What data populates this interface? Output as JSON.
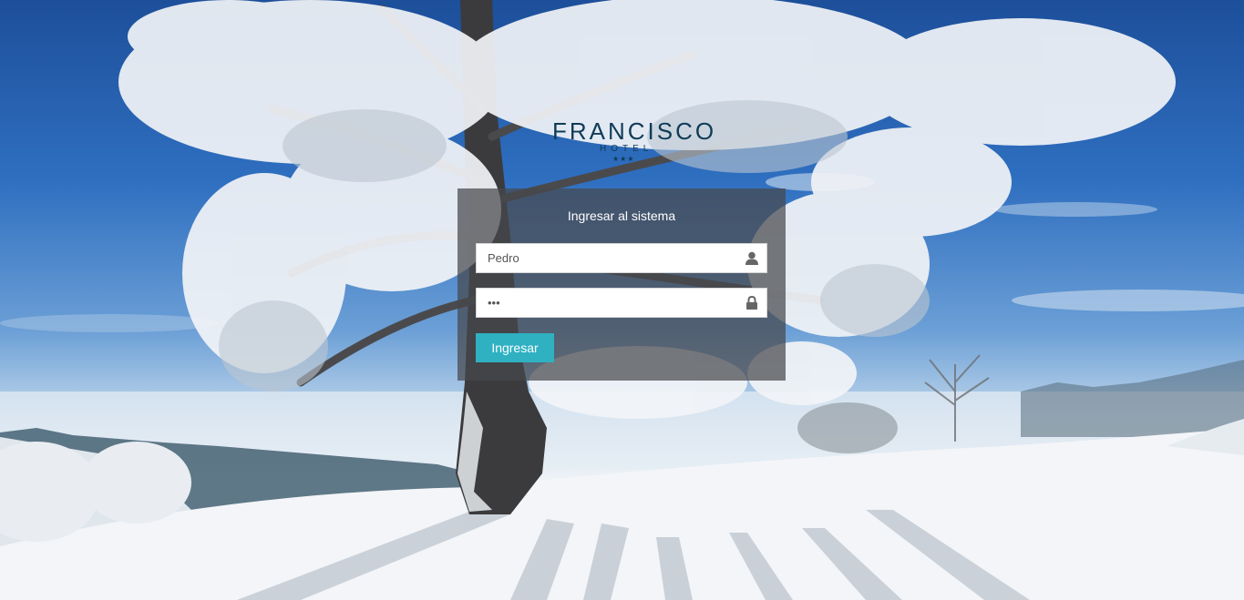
{
  "brand": {
    "name": "FRANCISCO",
    "subtitle": "HOTEL",
    "stars": "★★★"
  },
  "login": {
    "title": "Ingresar al sistema",
    "username_value": "Pedro",
    "password_value": "•••",
    "submit_label": "Ingresar"
  },
  "icons": {
    "user": "user-icon",
    "lock": "lock-icon"
  },
  "colors": {
    "button": "#2fb1c2",
    "panel": "rgba(70,72,76,0.72)",
    "logo": "#0f3b57"
  }
}
